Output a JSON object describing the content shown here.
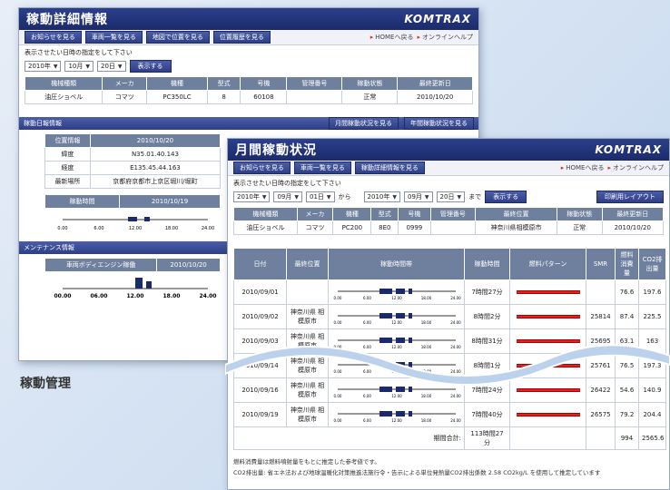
{
  "back_window": {
    "title": "稼動詳細情報",
    "logo": "KOMTRAX",
    "nav": [
      "お知らせを見る",
      "車両一覧を見る",
      "地図で位置を見る",
      "位置履歴を見る"
    ],
    "nav_links": [
      "HOMEへ戻る",
      "オンラインヘルプ"
    ],
    "date_label": "表示させたい日時の指定をして下さい",
    "date": {
      "year": "2010年",
      "month": "10月",
      "day": "20日"
    },
    "show_button": "表示する",
    "machine_table": {
      "headers": [
        "機械種類",
        "メーカ",
        "機種",
        "型式",
        "号機",
        "管理番号",
        "稼動状態",
        "最終更新日"
      ],
      "row": [
        "油圧ショベル",
        "コマツ",
        "PC350LC",
        "8",
        "60108",
        "",
        "正常",
        "2010/10/20"
      ]
    },
    "daily_panel": {
      "title": "稼動日報情報",
      "buttons": [
        "月間稼動状況を見る",
        "年間稼動状況を見る"
      ],
      "position_rows": [
        {
          "label": "位置情報",
          "value": "2010/10/20"
        },
        {
          "label": "緯度",
          "value": "N35.01.40.143"
        },
        {
          "label": "経度",
          "value": "E135.45.44.163"
        },
        {
          "label": "最新場所",
          "value": "京都府京都市上京区堀川/堀町"
        }
      ],
      "timeline_label": "稼動時間",
      "timeline_date": "2010/10/19",
      "ticks": [
        "0.00",
        "6.00",
        "12.00",
        "18.00",
        "24.00"
      ]
    },
    "maint_panel": {
      "title": "メンテナンス情報",
      "row_label": "車両ボディエンジン稼働",
      "row_date": "2010/10/20",
      "ticks": [
        "00.00",
        "06.00",
        "12.00",
        "18.00",
        "24.00"
      ]
    }
  },
  "caption": "稼動管理",
  "front_window": {
    "title": "月間稼動状況",
    "logo": "KOMTRAX",
    "nav": [
      "お知らせを見る",
      "車両一覧を見る",
      "稼動詳細情報を見る"
    ],
    "nav_links": [
      "HOMEへ戻る",
      "オンラインヘルプ"
    ],
    "date_label": "表示させたい日時の指定をして下さい",
    "from": {
      "year": "2010年",
      "month": "09月",
      "day": "01日",
      "suffix": "から"
    },
    "to": {
      "year": "2010年",
      "month": "09月",
      "day": "20日",
      "suffix": "まで"
    },
    "show_button": "表示する",
    "print_button": "印刷用レイアウト",
    "machine_table": {
      "headers": [
        "機械種類",
        "メーカ",
        "機種",
        "型式",
        "号機",
        "管理番号",
        "最終位置",
        "稼動状態",
        "最終更新日"
      ],
      "row": [
        "油圧ショベル",
        "コマツ",
        "PC200",
        "8E0",
        "0999",
        "",
        "神奈川県相模原市",
        "正常",
        "2010/10/20"
      ]
    },
    "daily_headers": [
      "日付",
      "最終位置",
      "稼動時間帯",
      "稼動時間",
      "燃料パターン",
      "SMR",
      "燃料消費量",
      "CO2排出量"
    ],
    "rows": [
      {
        "date": "2010/09/01",
        "place": "",
        "hours": "7時間27分",
        "smr": "",
        "fuel": "76.6",
        "co2": "197.6"
      },
      {
        "date": "2010/09/02",
        "place": "神奈川県 相模原市",
        "hours": "8時間2分",
        "smr": "25814",
        "fuel": "87.4",
        "co2": "225.5"
      },
      {
        "date": "2010/09/03",
        "place": "神奈川県 相模原市",
        "hours": "8時間31分",
        "smr": "25695",
        "fuel": "63.1",
        "co2": "163"
      },
      {
        "date": "2010/09/14",
        "place": "神奈川県 相模原市",
        "hours": "8時間1分",
        "smr": "25761",
        "fuel": "76.5",
        "co2": "197.3"
      },
      {
        "date": "2010/09/16",
        "place": "神奈川県 相模原市",
        "hours": "7時間24分",
        "smr": "26422",
        "fuel": "54.6",
        "co2": "140.9"
      },
      {
        "date": "2010/09/19",
        "place": "神奈川県 相模原市",
        "hours": "7時間40分",
        "smr": "26575",
        "fuel": "79.2",
        "co2": "204.4"
      }
    ],
    "total_label": "期間合計:",
    "total_hours": "113時間27分",
    "total_fuel": "994",
    "total_co2": "2565.6",
    "footnotes": [
      "燃料消費量は燃料噴射量をもとに推定した参考値です。",
      "CO2排出量: 省エネ法および地球温暖化対策推進法施行令・告示による単位発熱量CO2排出係数 2.58 CO2kg/L を使用して推定しています"
    ],
    "bar_ticks": [
      "0.00",
      "6.00",
      "12.00",
      "18.00",
      "24.00"
    ]
  },
  "colors": {
    "nav_blue": "#2e3f86",
    "fuel_red": "#d22",
    "header_gray": "#6f7f9e"
  }
}
